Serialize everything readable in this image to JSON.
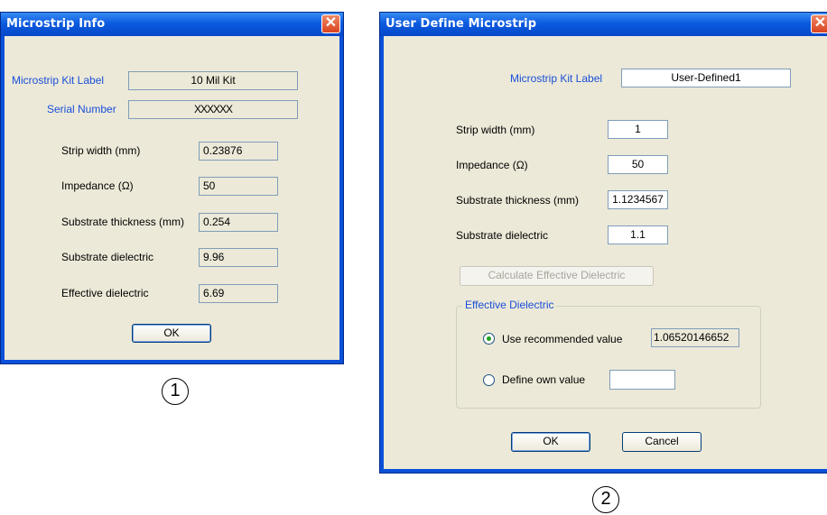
{
  "dialog1": {
    "title": "Microstrip Info",
    "close_glyph": "✕",
    "kit_label_caption": "Microstrip Kit Label",
    "kit_label_value": "10 Mil Kit",
    "serial_caption": "Serial Number",
    "serial_value": "XXXXXX",
    "rows": [
      {
        "label": "Strip width (mm)",
        "value": "0.23876"
      },
      {
        "label": "Impedance (Ω)",
        "value": "50"
      },
      {
        "label": "Substrate thickness (mm)",
        "value": "0.254"
      },
      {
        "label": "Substrate dielectric",
        "value": "9.96"
      },
      {
        "label": "Effective dielectric",
        "value": "6.69"
      }
    ],
    "ok_label": "OK",
    "marker": "1"
  },
  "dialog2": {
    "title": "User Define Microstrip",
    "close_glyph": "✕",
    "kit_label_caption": "Microstrip Kit Label",
    "kit_label_value": "User-Defined1",
    "rows": [
      {
        "label": "Strip width (mm)",
        "value": "1"
      },
      {
        "label": "Impedance (Ω)",
        "value": "50"
      },
      {
        "label": "Substrate thickness (mm)",
        "value": "1.1234567"
      },
      {
        "label": "Substrate dielectric",
        "value": "1.1"
      }
    ],
    "calc_button_label": "Calculate Effective Dielectric",
    "group_title": "Effective Dielectric",
    "recommended_label": "Use recommended value",
    "recommended_value": "1.06520146652",
    "recommended_selected": true,
    "own_label": "Define own value",
    "own_value": "",
    "ok_label": "OK",
    "cancel_label": "Cancel",
    "marker": "2"
  }
}
